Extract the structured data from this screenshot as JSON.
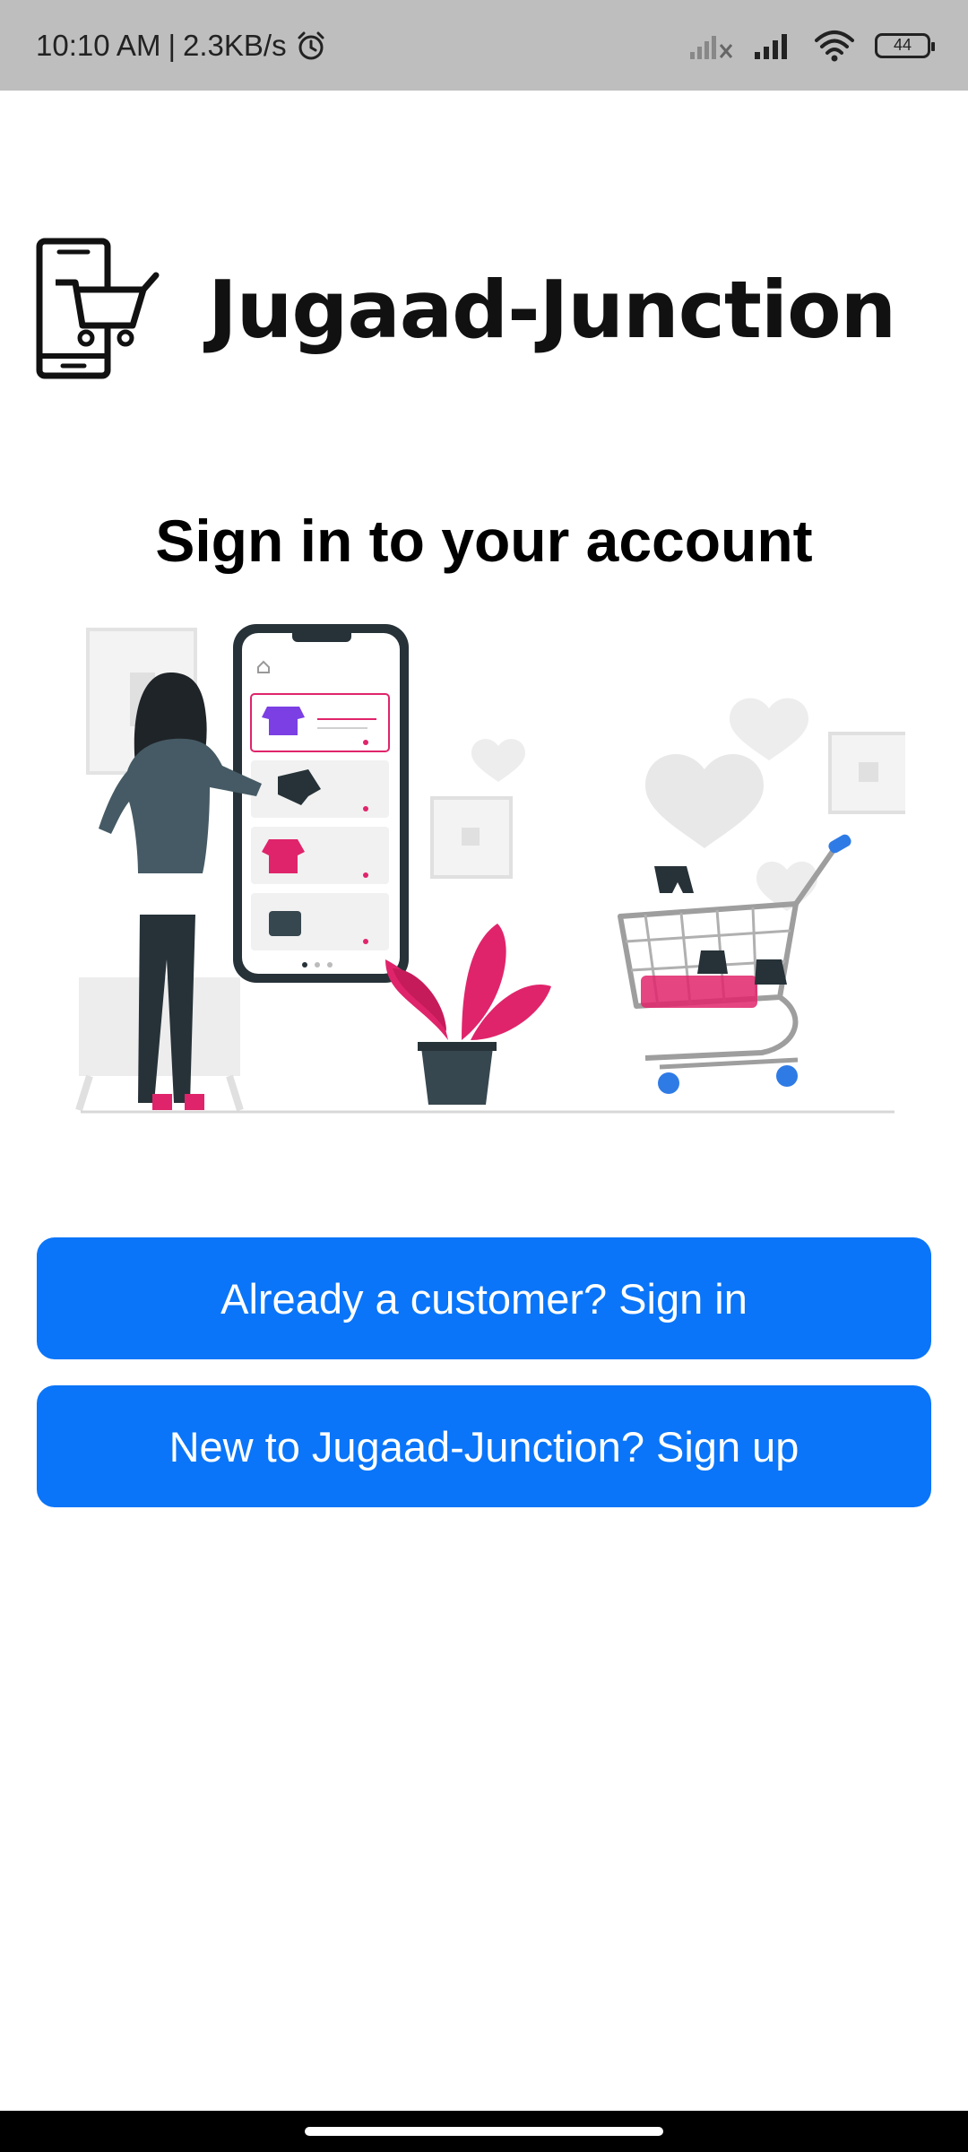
{
  "status_bar": {
    "time": "10:10 AM",
    "separator": "|",
    "speed": "2.3KB/s",
    "battery": "44",
    "icons": [
      "alarm-icon",
      "no-signal-icon",
      "signal-icon",
      "wifi-icon",
      "battery-icon"
    ]
  },
  "brand": {
    "name": "Jugaad-Junction",
    "logo_icon": "phone-cart-icon"
  },
  "title": "Sign in to your account",
  "buttons": {
    "signin": "Already a customer? Sign in",
    "signup": "New to Jugaad-Junction? Sign up"
  },
  "colors": {
    "status_bar": "#bebebe",
    "button": "#0a75f8",
    "button_text": "#ffffff",
    "accent_pink": "#e0246b",
    "accent_purple": "#7b3fe4"
  }
}
